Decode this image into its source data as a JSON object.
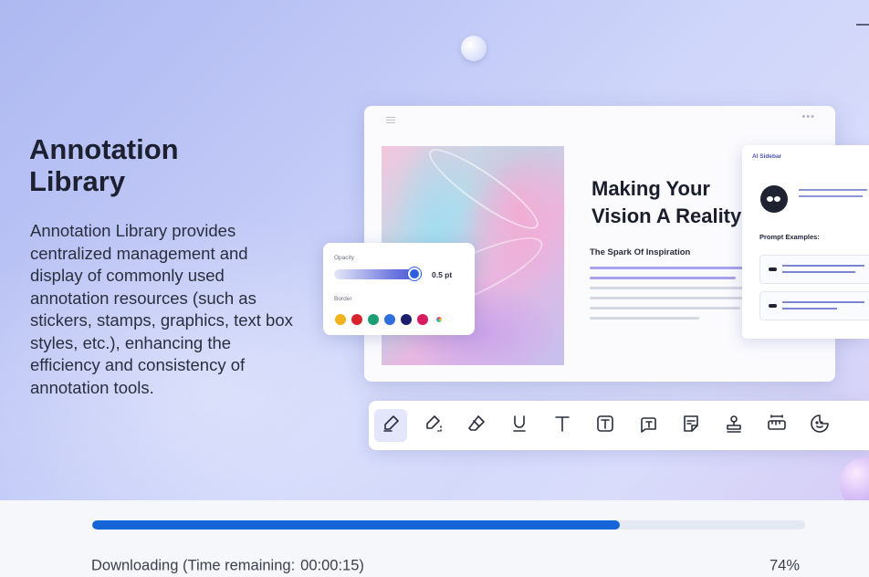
{
  "hero": {
    "title": "Annotation Library",
    "description": "Annotation Library provides centralized management and display of commonly used annotation resources (such as stickers, stamps, graphics, text box styles, etc.), enhancing the efficiency and consistency of annotation tools."
  },
  "preview": {
    "doc_title": "Making Your Vision A Reality",
    "doc_subtitle": "The Spark Of Inspiration",
    "popup": {
      "opacity_label": "Opacity",
      "opacity_value": "0.5 pt",
      "opacity_level": 0.92,
      "border_label": "Border",
      "swatches": [
        "#f2b21c",
        "#d8242d",
        "#1a9f74",
        "#2f6fdc",
        "#1e1e6e",
        "#d81b60",
        "rainbow"
      ]
    },
    "ai_panel": {
      "header": "AI Sidebar",
      "prompt_heading": "Prompt Examples:"
    }
  },
  "toolbar": {
    "tools": [
      {
        "icon": "highlighter-icon",
        "active": true
      },
      {
        "icon": "area-highlight-icon",
        "active": false
      },
      {
        "icon": "eraser-icon",
        "active": false
      },
      {
        "icon": "underline-icon",
        "active": false
      },
      {
        "icon": "text-icon",
        "active": false
      },
      {
        "icon": "textbox-icon",
        "active": false
      },
      {
        "icon": "callout-icon",
        "active": false
      },
      {
        "icon": "note-icon",
        "active": false
      },
      {
        "icon": "stamp-icon",
        "active": false
      },
      {
        "icon": "measure-icon",
        "active": false
      },
      {
        "icon": "sticker-icon",
        "active": false
      }
    ]
  },
  "download": {
    "status_label": "Downloading (Time remaining:",
    "time_remaining": "00:00:15)",
    "percent_text": "74%",
    "progress": 0.74
  },
  "colors": {
    "progress_fill": "#1565d8",
    "progress_track": "#e4e8f2",
    "accent": "#4353d6"
  }
}
